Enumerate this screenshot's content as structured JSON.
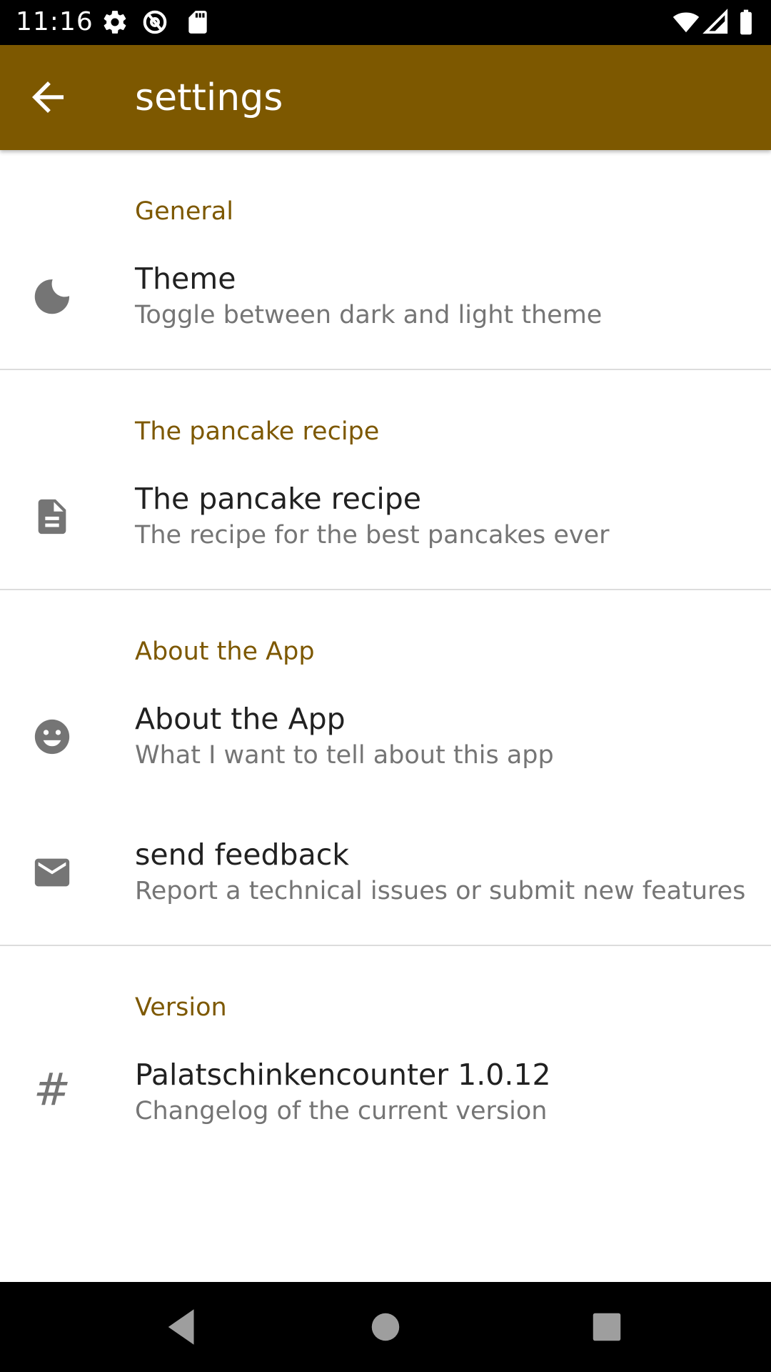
{
  "status_bar": {
    "time": "11:16",
    "icons": [
      "gear-icon",
      "at-icon",
      "sd-card-icon",
      "wifi-icon",
      "signal-icon",
      "battery-icon"
    ]
  },
  "app_bar": {
    "title": "settings",
    "background": "#7d5800",
    "back_icon": "arrow-back-icon"
  },
  "colors": {
    "accent": "#7d5800",
    "title_text": "#212121",
    "summary_text": "#757575",
    "icon": "#757575"
  },
  "sections": [
    {
      "title": "General",
      "items": [
        {
          "title": "Theme",
          "summary": "Toggle between dark and light theme",
          "icon": "moon-icon"
        }
      ]
    },
    {
      "title": "The pancake recipe",
      "items": [
        {
          "title": "The pancake recipe",
          "summary": "The recipe for the best pancakes ever",
          "icon": "document-icon"
        }
      ]
    },
    {
      "title": "About the App",
      "items": [
        {
          "title": "About the App",
          "summary": "What I want to tell about this app",
          "icon": "smiley-icon"
        },
        {
          "title": "send feedback",
          "summary": "Report a technical issues or submit new features",
          "icon": "mail-icon"
        }
      ]
    },
    {
      "title": "Version",
      "items": [
        {
          "title": "Palatschinkencounter 1.0.12",
          "summary": "Changelog of the current version",
          "icon": "hash-icon",
          "glyph": "#"
        }
      ]
    }
  ],
  "nav_bar": {
    "buttons": [
      "back-triangle-icon",
      "home-circle-icon",
      "recents-square-icon"
    ]
  }
}
